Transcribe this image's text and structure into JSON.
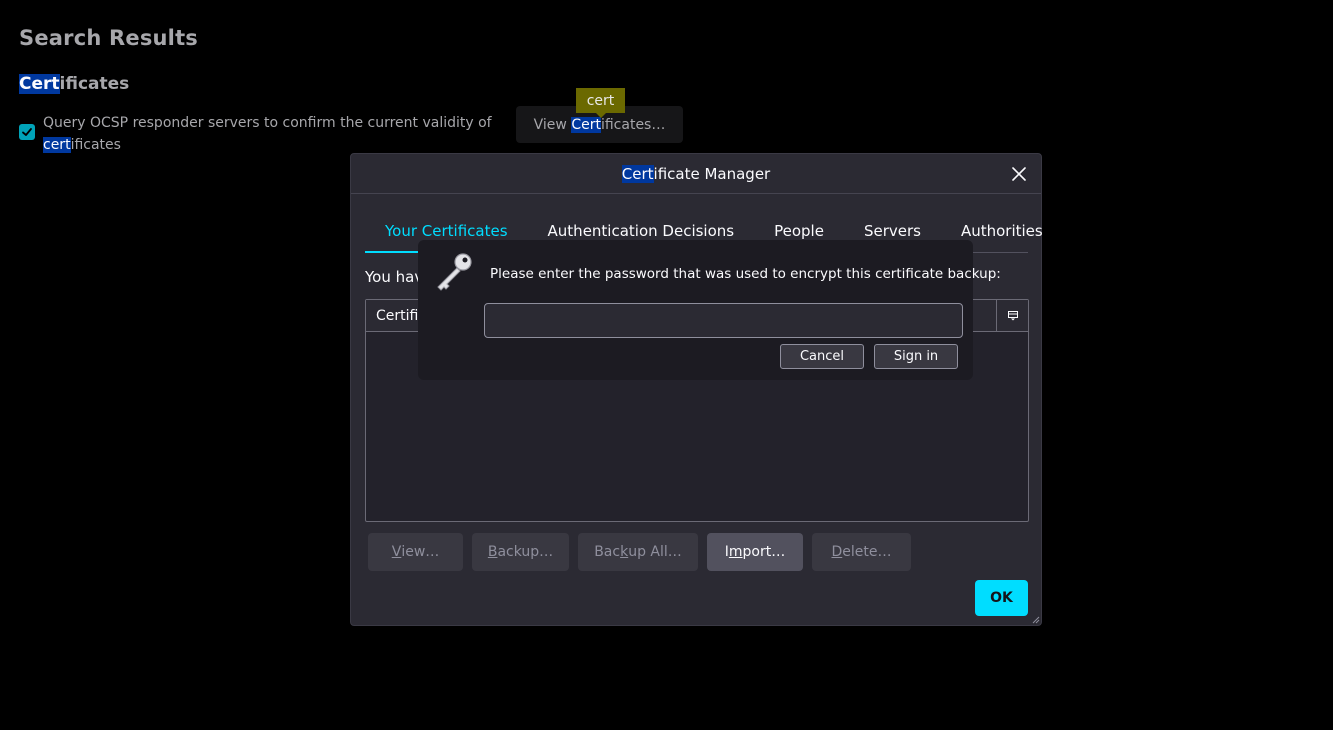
{
  "background": {
    "title": "Search Results",
    "section": {
      "highlight": "Cert",
      "rest": "ificates"
    },
    "ocsp": {
      "checked": true,
      "text_before": "Query OCSP responder servers to confirm the current validity of ",
      "highlight": "cert",
      "text_after": "ificates"
    },
    "view_button": {
      "before": "View ",
      "highlight": "Cert",
      "after": "ificates…"
    },
    "tooltip": "cert"
  },
  "dialog": {
    "title_highlight": "Cert",
    "title_rest": "ificate Manager",
    "tabs": [
      {
        "label": "Your Certificates",
        "active": true
      },
      {
        "label": "Authentication Decisions",
        "active": false
      },
      {
        "label": "People",
        "active": false
      },
      {
        "label": "Servers",
        "active": false
      },
      {
        "label": "Authorities",
        "active": false
      }
    ],
    "description": "You hav",
    "tree_header": "Certifi",
    "buttons": {
      "view": {
        "accesskey": "V",
        "rest": "iew…"
      },
      "backup": {
        "accesskey": "B",
        "rest": "ackup…"
      },
      "backup_all": {
        "pre": "Bac",
        "accesskey": "k",
        "rest": "up All…"
      },
      "import": {
        "pre": "I",
        "accesskey": "m",
        "rest": "port…"
      },
      "delete": {
        "accesskey": "D",
        "rest": "elete…"
      }
    },
    "ok": "OK"
  },
  "prompt": {
    "message": "Please enter the password that was used to encrypt this certificate backup:",
    "password_value": "",
    "cancel": "Cancel",
    "sign_in": "Sign in",
    "icon": "key-icon"
  },
  "colors": {
    "accent": "#00ddff",
    "highlight": "#00389f",
    "dialog_bg": "#2b2a33",
    "prompt_bg": "#1c1b22",
    "tooltip_bg": "#6b6900"
  }
}
